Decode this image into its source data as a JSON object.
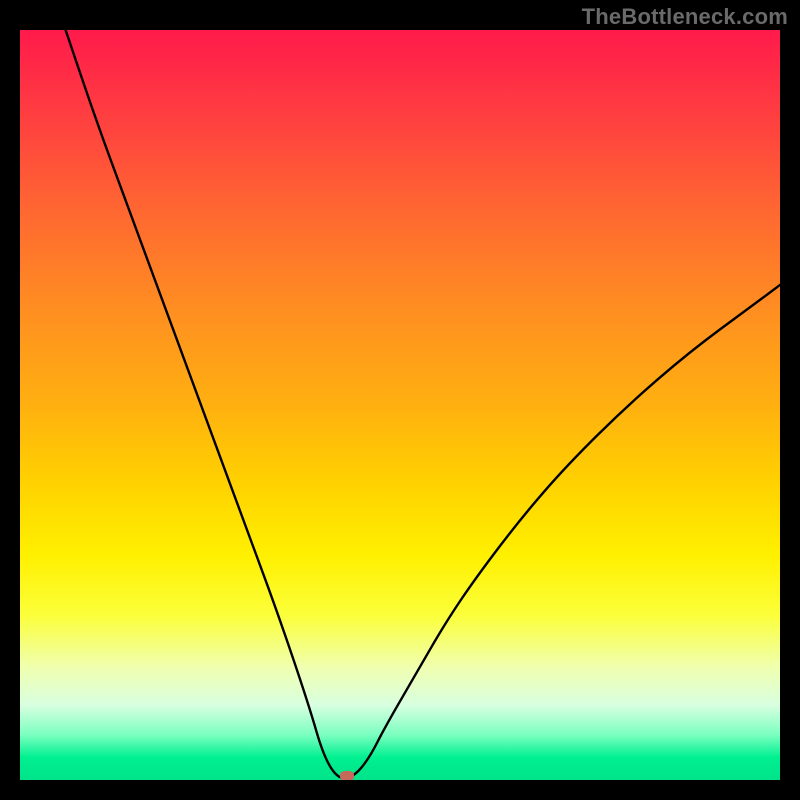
{
  "watermark": "TheBottleneck.com",
  "colors": {
    "frame": "#000000",
    "curve": "#000000",
    "marker": "#c56a5a",
    "gradient_stops": [
      "#ff1a4b",
      "#ff4040",
      "#ff6a30",
      "#ff9020",
      "#ffb010",
      "#ffd000",
      "#fff000",
      "#fbff3a",
      "#f0ffb0",
      "#d8ffe0",
      "#7affc0",
      "#00f090",
      "#00e38a"
    ]
  },
  "chart_data": {
    "type": "line",
    "title": "",
    "xlabel": "",
    "ylabel": "",
    "xlim": [
      0,
      100
    ],
    "ylim": [
      0,
      100
    ],
    "grid": false,
    "legend": null,
    "description": "V-shaped bottleneck curve over a vertical heat gradient; minimum near x≈42 at y≈0; left branch rises to top-left corner, right branch rises to roughly (100,66).",
    "series": [
      {
        "name": "bottleneck-curve",
        "x": [
          6,
          10,
          14,
          18,
          22,
          26,
          30,
          34,
          38,
          40,
          42,
          44,
          46,
          48,
          52,
          56,
          60,
          66,
          72,
          80,
          88,
          96,
          100
        ],
        "y": [
          100,
          88,
          77,
          66,
          55,
          44,
          33,
          22,
          10,
          3,
          0,
          0.5,
          3,
          7,
          14,
          21,
          27,
          35,
          42,
          50,
          57,
          63,
          66
        ]
      }
    ],
    "marker": {
      "x": 43,
      "y": 0.5
    }
  }
}
